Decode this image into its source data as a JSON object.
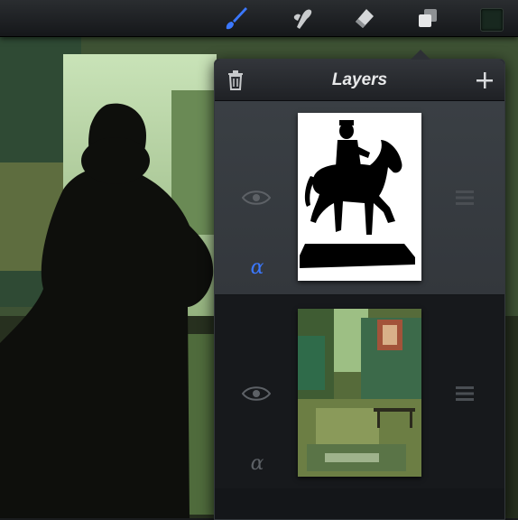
{
  "toolbar": {
    "tools": [
      {
        "name": "brush",
        "icon": "brush-icon",
        "active": true
      },
      {
        "name": "smudge",
        "icon": "smudge-icon",
        "active": false
      },
      {
        "name": "eraser",
        "icon": "eraser-icon",
        "active": false
      },
      {
        "name": "layers",
        "icon": "layers-icon",
        "active": false
      }
    ],
    "color": "#18281f",
    "accent": "#2f6bff"
  },
  "layers_panel": {
    "title": "Layers",
    "delete_icon": "trash-icon",
    "add_icon": "plus-icon",
    "layers": [
      {
        "thumbnail": "equestrian-statue-silhouette",
        "visible": true,
        "alpha_lock": true,
        "selected": true
      },
      {
        "thumbnail": "green-interior-painting",
        "visible": true,
        "alpha_lock": false,
        "selected": false
      }
    ],
    "alpha_symbol": "α"
  }
}
